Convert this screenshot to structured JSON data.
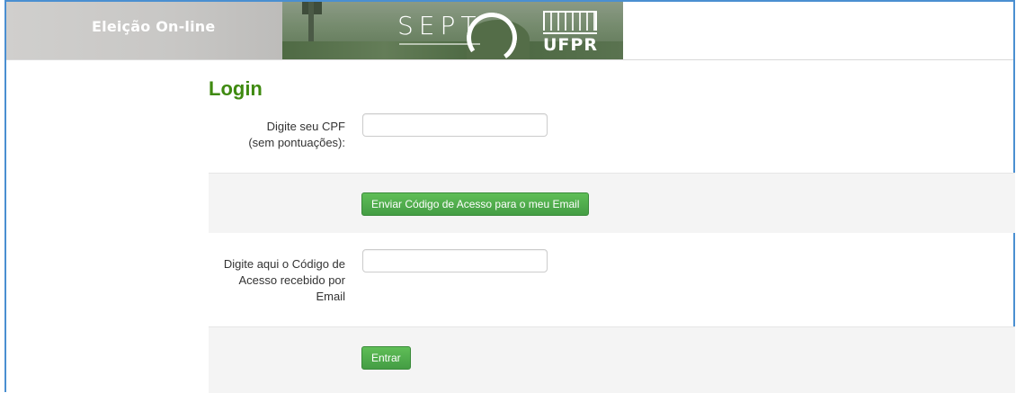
{
  "header": {
    "brand": "Eleição On-line",
    "banner_sept": "SEPT",
    "banner_ufpr": "UFPR"
  },
  "login": {
    "title": "Login",
    "cpf_label_line1": "Digite seu CPF",
    "cpf_label_line2": "(sem pontuações):",
    "cpf_value": "",
    "send_code_label": "Enviar Código de Acesso para o meu Email",
    "code_label_line1": "Digite aqui o Código de",
    "code_label_line2": "Acesso recebido por",
    "code_label_line3": "Email",
    "code_value": "",
    "submit_label": "Entrar"
  },
  "colors": {
    "accent": "#3f8a10",
    "button": "#449d44",
    "frame": "#4a8fd1"
  }
}
